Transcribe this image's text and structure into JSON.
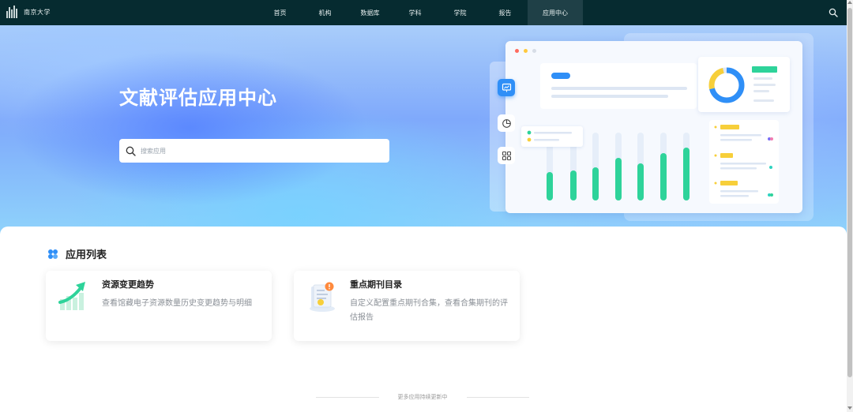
{
  "brand": {
    "name": "南京大学"
  },
  "nav": {
    "items": [
      {
        "label": "首页"
      },
      {
        "label": "机构"
      },
      {
        "label": "数据库"
      },
      {
        "label": "学科"
      },
      {
        "label": "学院"
      },
      {
        "label": "报告"
      },
      {
        "label": "应用中心"
      }
    ],
    "active_index": 6
  },
  "hero": {
    "title": "文献评估应用中心",
    "search_placeholder": "搜索应用"
  },
  "apps_section": {
    "title": "应用列表",
    "apps": [
      {
        "title": "资源变更趋势",
        "description": "查看馆藏电子资源数量历史变更趋势与明细",
        "icon": "trend-arrow-icon"
      },
      {
        "title": "重点期刊目录",
        "description": "自定义配置重点期刊合集，查看合集期刊的评估报告",
        "icon": "journal-badge-icon"
      }
    ],
    "footer_note": "更多应用持续更新中"
  },
  "colors": {
    "nav_bg": "#062b30",
    "accent_blue": "#2f8ff7",
    "accent_green": "#2ed39a",
    "accent_yellow": "#f7cf3a"
  }
}
